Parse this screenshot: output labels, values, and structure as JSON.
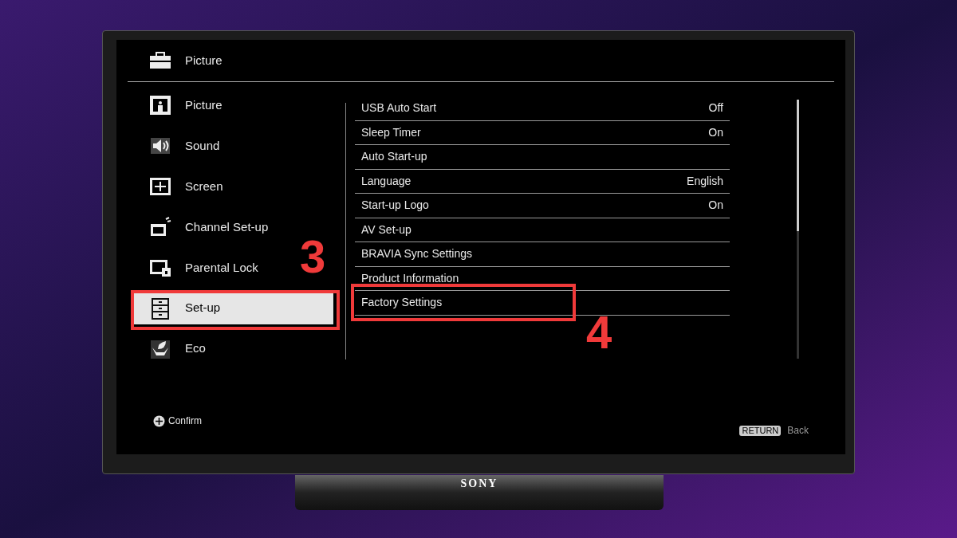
{
  "header": {
    "title": "Picture",
    "kind": "toolbox"
  },
  "categories": [
    {
      "label": "Picture",
      "kind": "picture",
      "selected": false
    },
    {
      "label": "Sound",
      "kind": "sound",
      "selected": false
    },
    {
      "label": "Screen",
      "kind": "screen",
      "selected": false
    },
    {
      "label": "Channel Set-up",
      "kind": "channel",
      "selected": false
    },
    {
      "label": "Parental Lock",
      "kind": "lock",
      "selected": false
    },
    {
      "label": "Set-up",
      "kind": "setup",
      "selected": true
    },
    {
      "label": "Eco",
      "kind": "eco",
      "selected": false
    }
  ],
  "settings": [
    {
      "label": "USB Auto Start",
      "value": "Off"
    },
    {
      "label": "Sleep Timer",
      "value": "On"
    },
    {
      "label": "Auto Start-up"
    },
    {
      "label": "Language",
      "value": "English"
    },
    {
      "label": "Start-up Logo",
      "value": "On"
    },
    {
      "label": "AV Set-up"
    },
    {
      "label": "BRAVIA Sync Settings"
    },
    {
      "label": "Product Information"
    },
    {
      "label": "Factory Settings"
    }
  ],
  "footer": {
    "confirm": "Confirm",
    "return_key": "RETURN",
    "return_label": "Back"
  },
  "brand": "SONY",
  "annotations": [
    {
      "number": "3"
    },
    {
      "number": "4"
    }
  ]
}
